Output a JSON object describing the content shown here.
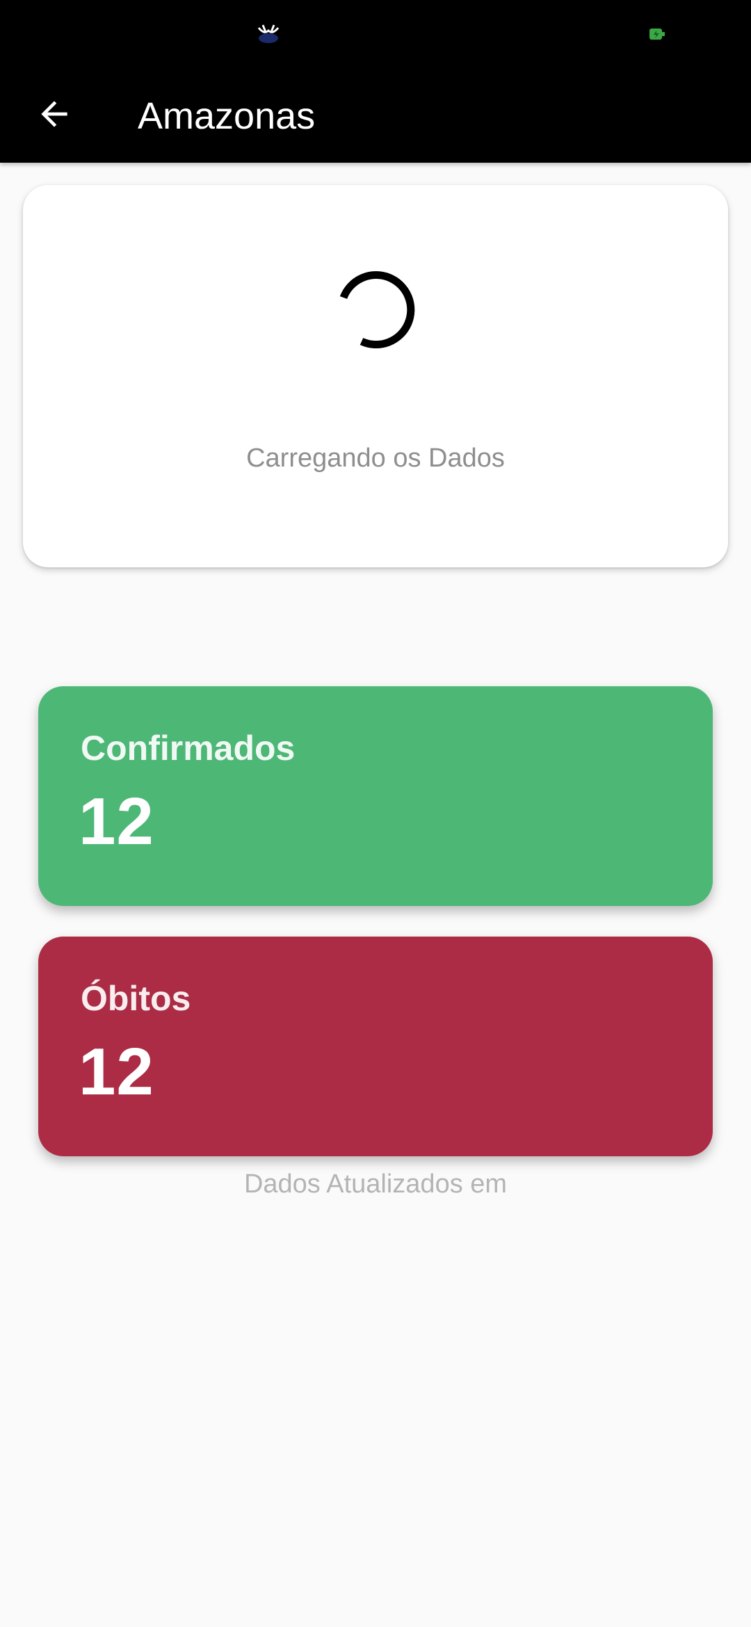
{
  "colors": {
    "app_bar": "#000000",
    "background": "#fafafa",
    "confirmed_card": "#4db776",
    "deaths_card": "#ac2c45",
    "status_icon_right": "#3aa844"
  },
  "status_bar": {
    "left_icon": "notification-app-icon",
    "right_icon": "battery-icon"
  },
  "app_bar": {
    "back_icon": "arrow-back-icon",
    "title": "Amazonas"
  },
  "loading": {
    "icon": "loading-spinner",
    "text": "Carregando os Dados"
  },
  "stats": {
    "confirmed": {
      "label": "Confirmados",
      "value": "12"
    },
    "deaths": {
      "label": "Óbitos",
      "value": "12"
    }
  },
  "footer": {
    "updated_label": "Dados Atualizados em"
  }
}
